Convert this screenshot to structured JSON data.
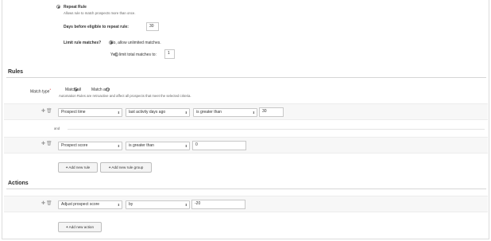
{
  "repeat": {
    "title": "Repeat Rule",
    "help": "Allows rule to match prospects more than once.",
    "days_label": "Days before eligible to repeat rule:",
    "days_value": "30",
    "limit_label": "Limit rule matches?",
    "option_unlimited": "No, allow unlimited matches.",
    "option_limited": "Yes, limit total matches to:",
    "limit_value": "1"
  },
  "rules": {
    "heading": "Rules",
    "match_type_label": "Match type",
    "match_all": "Match all",
    "match_any": "Match any",
    "note": "Automation Rules are retroactive and affect all prospects that meet the selected criteria.",
    "and_label": "and",
    "rule1": {
      "field": "Prospect time",
      "criterion": "last activity days ago",
      "operator": "is greater than",
      "value": "30"
    },
    "rule2": {
      "field": "Prospect score",
      "operator": "is greater than",
      "value": "0"
    },
    "add_rule": "Add new rule",
    "add_rule_group": "Add new rule group"
  },
  "actions": {
    "heading": "Actions",
    "action1": {
      "action": "Adjust prospect score",
      "mode": "by",
      "value": "-20"
    },
    "add_action": "Add new action"
  },
  "icons": {
    "add": "plus-icon",
    "delete": "trash-icon",
    "dropdown": "chevron-down-icon"
  }
}
